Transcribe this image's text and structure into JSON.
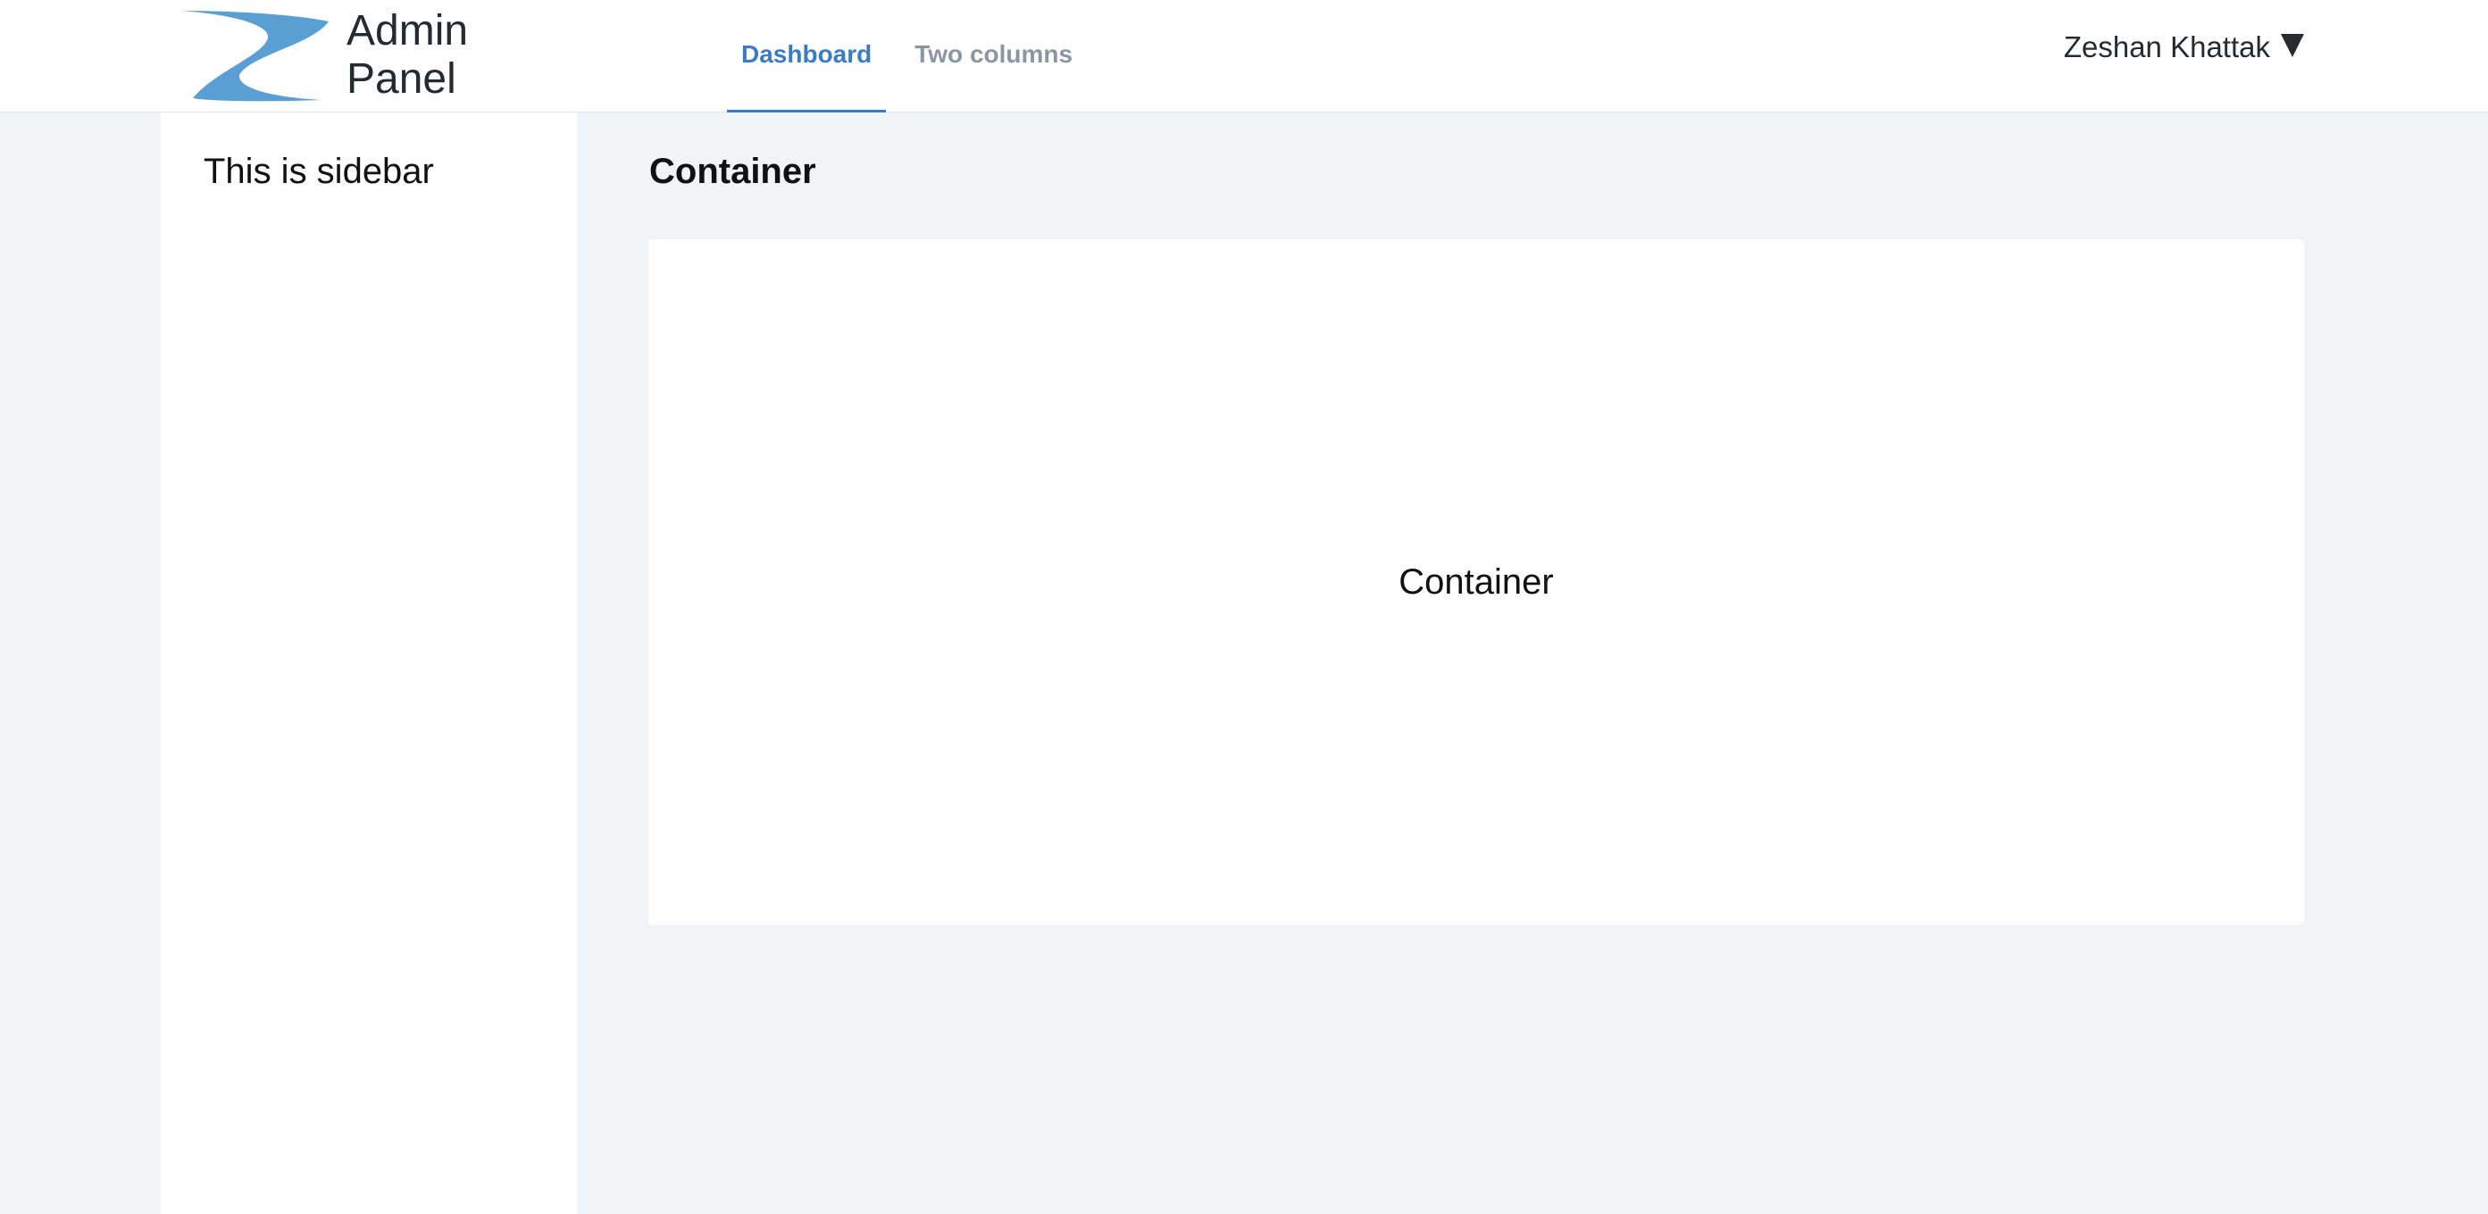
{
  "header": {
    "brand_title": "Admin\nPanel",
    "logo_icon": "swoosh-logo-icon",
    "nav_tabs": [
      {
        "label": "Dashboard",
        "active": true
      },
      {
        "label": "Two columns",
        "active": false
      }
    ],
    "user_name": "Zeshan Khattak",
    "user_menu_icon": "caret-down-icon"
  },
  "sidebar": {
    "text": "This is sidebar"
  },
  "main": {
    "title": "Container",
    "panel_text": "Container"
  },
  "colors": {
    "accent": "#3b7cc4",
    "logo": "#5a9fd4",
    "background": "#f0f4f7",
    "surface": "#ffffff",
    "muted_tab": "#8a96a3"
  }
}
